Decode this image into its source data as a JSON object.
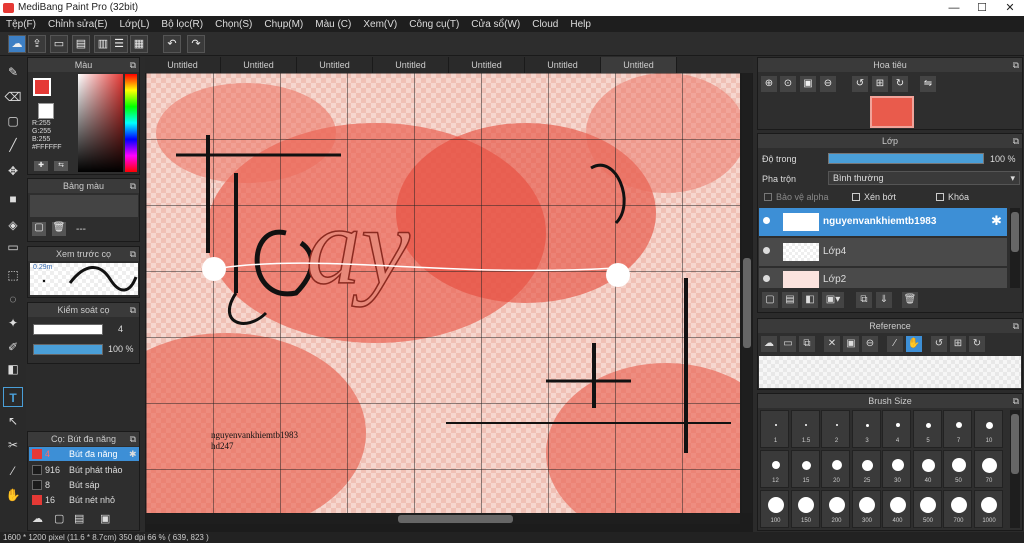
{
  "title": "MediBang Paint Pro (32bit)",
  "window_controls": {
    "minimize": "—",
    "maximize": "☐",
    "close": "✕"
  },
  "menu": [
    "Tệp(F)",
    "Chỉnh sửa(E)",
    "Lớp(L)",
    "Bộ lọc(R)",
    "Chọn(S)",
    "Chụp(M)",
    "Màu (C)",
    "Xem(V)",
    "Công cụ(T)",
    "Cửa sổ(W)",
    "Cloud",
    "Help"
  ],
  "tabs": [
    "Untitled",
    "Untitled",
    "Untitled",
    "Untitled",
    "Untitled",
    "Untitled",
    "Untitled"
  ],
  "color_panel": {
    "title": "Màu",
    "r": "R:255",
    "g": "G:255",
    "b": "B:255",
    "hex": "#FFFFFF"
  },
  "palette_panel": {
    "title": "Bảng màu",
    "dashes": "---"
  },
  "preview_panel": {
    "title": "Xem trước cọ",
    "size": "0.29m"
  },
  "brush_control": {
    "title": "Kiểm soát cọ",
    "size": "4",
    "opacity": "100 %"
  },
  "brush_list": {
    "title": "Cọ: Bút đa năng",
    "items": [
      {
        "size": "4",
        "name": "Bút đa năng",
        "color": "#e53935",
        "active": true
      },
      {
        "size": "916",
        "name": "Bút phát thảo",
        "color": "#1b1b1b",
        "active": false
      },
      {
        "size": "8",
        "name": "Bút sáp",
        "color": "#1b1b1b",
        "active": false
      },
      {
        "size": "16",
        "name": "Bút nét nhỏ",
        "color": "#e53935",
        "active": false
      }
    ]
  },
  "navigator": {
    "title": "Hoa tiêu"
  },
  "layers": {
    "title": "Lớp",
    "opacity_label": "Độ trong",
    "opacity_value": "100 %",
    "blend_label": "Pha trộn",
    "blend_value": "Bình thường",
    "protect_alpha": "Bảo vệ alpha",
    "clip": "Xén bớt",
    "lock": "Khóa",
    "items": [
      {
        "name": "nguyenvankhiemtb1983",
        "active": true
      },
      {
        "name": "Lớp4",
        "active": false
      },
      {
        "name": "Lớp2",
        "active": false
      }
    ]
  },
  "reference": {
    "title": "Reference"
  },
  "brush_size": {
    "title": "Brush Size",
    "sizes": [
      "1",
      "1.5",
      "2",
      "3",
      "4",
      "5",
      "7",
      "10",
      "12",
      "15",
      "20",
      "25",
      "30",
      "40",
      "50",
      "70",
      "100",
      "150",
      "200",
      "300",
      "400",
      "500",
      "700",
      "1000"
    ]
  },
  "canvas_text": {
    "name_line": "nguyenvankhiemtb1983",
    "sub_line": "hd247",
    "art_word": "ay"
  },
  "status": "1600 * 1200 pixel   (11.6 * 8.7cm)   350 dpi   66 %   ( 639, 823 )",
  "colors": {
    "accent": "#4a9fd8",
    "layer_active": "#3d8fd6",
    "canvas_bg": "#f3c9bf",
    "splash": "#e64a3b"
  }
}
